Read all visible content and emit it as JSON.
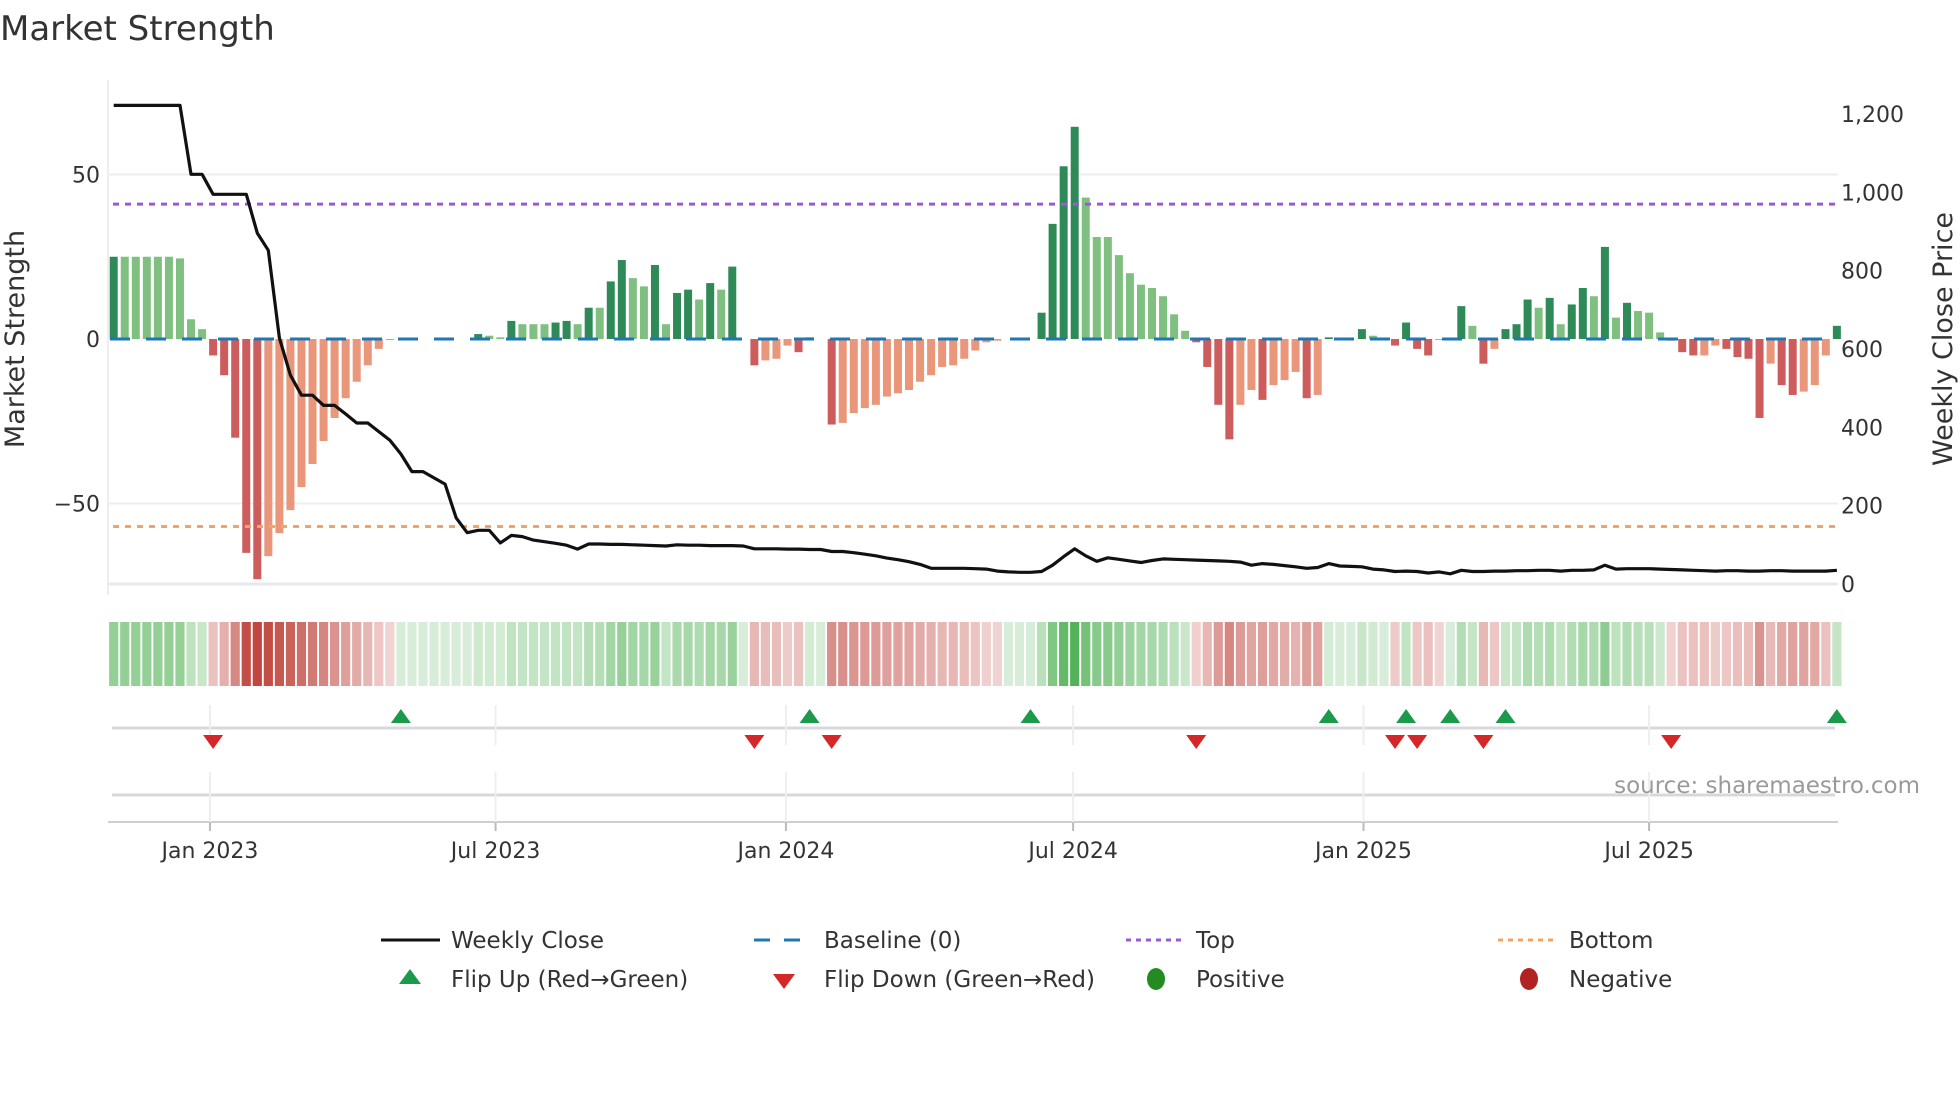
{
  "chart_data": {
    "type": "bar",
    "title": "Market Strength",
    "ylabel": "Market Strength",
    "y2label": "Weekly Close Price",
    "ylim": [
      -75,
      75
    ],
    "y2lim": [
      0,
      1280
    ],
    "start_date": "2022-11-01",
    "frequency": "weekly",
    "left_ticks": [
      {
        "value": 50,
        "label": "50"
      },
      {
        "value": 0,
        "label": "0"
      },
      {
        "value": -50,
        "label": "−50"
      }
    ],
    "right_ticks": [
      {
        "value": 0,
        "label": "0"
      },
      {
        "value": 200,
        "label": "200"
      },
      {
        "value": 400,
        "label": "400"
      },
      {
        "value": 600,
        "label": "600"
      },
      {
        "value": 800,
        "label": "800"
      },
      {
        "value": 1000,
        "label": "1,000"
      },
      {
        "value": 1200,
        "label": "1,200"
      }
    ],
    "x_ticks": [
      {
        "date": "2023-01-01",
        "label": "Jan 2023"
      },
      {
        "date": "2023-07-01",
        "label": "Jul 2023"
      },
      {
        "date": "2024-01-01",
        "label": "Jan 2024"
      },
      {
        "date": "2024-07-01",
        "label": "Jul 2024"
      },
      {
        "date": "2025-01-01",
        "label": "Jan 2025"
      },
      {
        "date": "2025-07-01",
        "label": "Jul 2025"
      }
    ],
    "top_level": 41,
    "bottom_level": -57,
    "baseline": 0,
    "strength": [
      25,
      25,
      25,
      25,
      25,
      25,
      24.5,
      6,
      3,
      -5,
      -11,
      -30,
      -65,
      -73,
      -66,
      -59,
      -52,
      -45,
      -38,
      -31,
      -24,
      -18,
      -13,
      -8,
      -3,
      -0.3,
      0,
      0,
      0,
      0,
      0,
      0,
      0,
      1.5,
      1,
      0.5,
      5.5,
      4.5,
      4.5,
      4.5,
      5,
      5.5,
      4.5,
      9.5,
      9.5,
      17.5,
      24,
      18.5,
      16,
      22.5,
      4.5,
      14,
      15,
      12,
      17,
      15,
      22,
      0,
      -8,
      -6.5,
      -6,
      -2,
      -4,
      0.5,
      0,
      -26,
      -25.5,
      -22.5,
      -21,
      -20,
      -17.5,
      -16.5,
      -15.5,
      -13,
      -11,
      -8.5,
      -8,
      -6,
      -3.5,
      -1,
      -0.5,
      0,
      0,
      0,
      8,
      35,
      52.5,
      64.5,
      43,
      31,
      31,
      25.5,
      20,
      16.5,
      15.5,
      13,
      7.5,
      2.5,
      -1,
      -8.5,
      -20,
      -30.5,
      -20,
      -15.5,
      -18.5,
      -14,
      -12.5,
      -10,
      -18,
      -17,
      0.5,
      0,
      0,
      3,
      1,
      0,
      -2,
      5,
      -3,
      -5,
      -0.3,
      0,
      10,
      4,
      -7.5,
      -3,
      3,
      4.5,
      12,
      9.5,
      12.5,
      4.5,
      10.5,
      15.5,
      13,
      28,
      6.5,
      11,
      8.5,
      8,
      2,
      -0.5,
      -4,
      -5,
      -5,
      -2,
      -3,
      -5.5,
      -6,
      -24,
      -7.5,
      -14,
      -17,
      -16,
      -14,
      -5,
      4
    ],
    "weekly_close": [
      1222,
      1222,
      1222,
      1222,
      1222,
      1222,
      1222,
      1046,
      1046,
      995,
      995,
      995,
      995,
      896,
      852,
      628,
      533,
      482,
      482,
      456,
      456,
      434,
      411,
      411,
      389,
      367,
      332,
      287,
      287,
      271,
      255,
      169,
      131,
      137,
      137,
      105,
      124,
      121,
      112,
      108,
      104,
      99,
      89,
      102,
      102,
      101,
      101,
      100,
      99,
      98,
      97,
      100,
      99,
      99,
      98,
      98,
      98,
      97,
      90,
      90,
      90,
      89,
      89,
      88,
      88,
      83,
      83,
      80,
      76,
      72,
      66,
      62,
      57,
      50,
      40,
      40,
      40,
      40,
      39,
      38,
      33,
      31,
      30,
      30,
      32,
      48,
      70,
      90,
      72,
      58,
      67,
      63,
      59,
      55,
      60,
      64,
      63,
      62,
      61,
      60,
      59,
      58,
      56,
      48,
      52,
      50,
      47,
      44,
      40,
      42,
      52,
      46,
      45,
      44,
      38,
      36,
      32,
      33,
      32,
      28,
      31,
      26,
      35,
      32,
      32,
      33,
      33,
      34,
      34,
      35,
      35,
      33,
      35,
      35,
      36,
      48,
      38,
      39,
      39,
      39,
      38,
      37,
      36,
      35,
      34,
      33,
      34,
      34,
      33,
      33,
      34,
      34,
      33,
      33,
      33,
      33,
      35
    ],
    "flip_up_dates": [
      "2023-05-02",
      "2024-01-16",
      "2024-06-04",
      "2024-12-10",
      "2025-01-28",
      "2025-02-25",
      "2025-04-01",
      "2025-10-28"
    ],
    "flip_down_dates": [
      "2023-01-03",
      "2023-12-12",
      "2024-01-30",
      "2024-09-17",
      "2025-01-21",
      "2025-02-04",
      "2025-03-18",
      "2025-07-15"
    ],
    "legend_placement": "bottom-center",
    "grid": true
  },
  "source": "source: sharemaestro.com",
  "legend": {
    "weekly_close": "Weekly Close",
    "baseline": "Baseline (0)",
    "top": "Top",
    "bottom": "Bottom",
    "flip_up": "Flip Up (Red→Green)",
    "flip_down": "Flip Down (Green→Red)",
    "positive": "Positive",
    "negative": "Negative"
  },
  "colors": {
    "bar_pos_rising": "#2e8b57",
    "bar_pos_falling": "#7fc080",
    "bar_neg_falling": "#cd5c5c",
    "bar_neg_rising": "#e9967a",
    "price": "#111111",
    "baseline": "#1f77b4",
    "top": "#9b59d6",
    "bottom": "#f4a460",
    "flip_up": "#1a9a4a",
    "flip_down": "#d62728",
    "positive": "#228b22",
    "negative": "#b22222"
  }
}
